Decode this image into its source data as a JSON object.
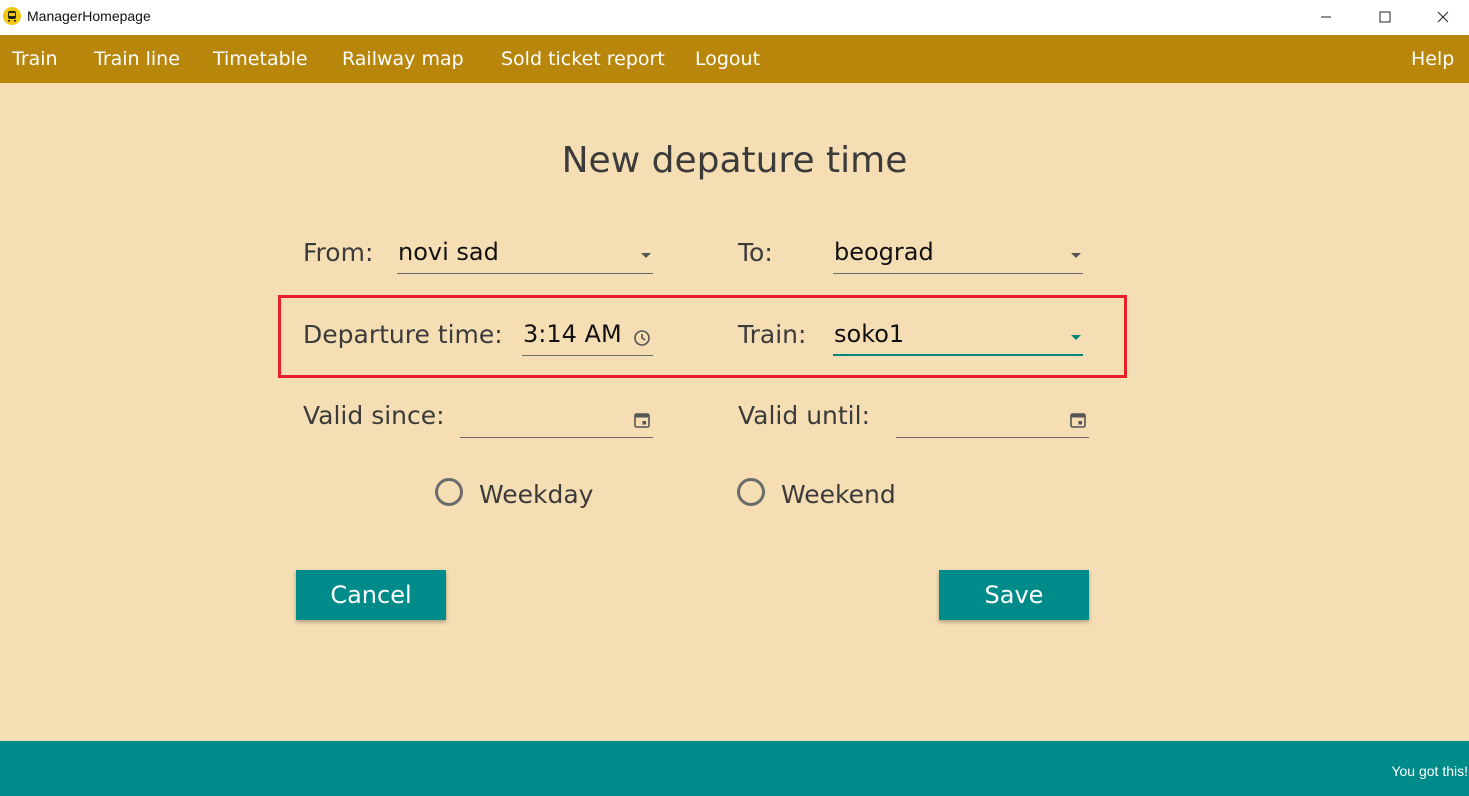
{
  "window": {
    "title": "ManagerHomepage",
    "app_icon": "train-icon",
    "controls": [
      "minimize-icon",
      "maximize-icon",
      "close-icon"
    ]
  },
  "menu": {
    "items": [
      "Train",
      "Train line",
      "Timetable",
      "Railway map",
      "Sold ticket report",
      "Logout"
    ],
    "help": "Help"
  },
  "form": {
    "title": "New depature time",
    "from": {
      "label": "From:",
      "value": "novi sad"
    },
    "to": {
      "label": "To:",
      "value": "beograd"
    },
    "departure_time": {
      "label": "Departure time:",
      "value": "3:14 AM",
      "icon": "clock-icon"
    },
    "train": {
      "label": "Train:",
      "value": "soko1"
    },
    "valid_since": {
      "label": "Valid since:",
      "value": "",
      "icon": "calendar-icon"
    },
    "valid_until": {
      "label": "Valid until:",
      "value": "",
      "icon": "calendar-icon"
    },
    "weekday": {
      "label": "Weekday",
      "checked": false
    },
    "weekend": {
      "label": "Weekend",
      "checked": false
    },
    "cancel_label": "Cancel",
    "save_label": "Save"
  },
  "footer": {
    "text": "You got this!"
  },
  "colors": {
    "background": "#f5deb3",
    "menubar": "#b8860b",
    "accent": "#008b8b",
    "highlight": "#e8202a"
  }
}
